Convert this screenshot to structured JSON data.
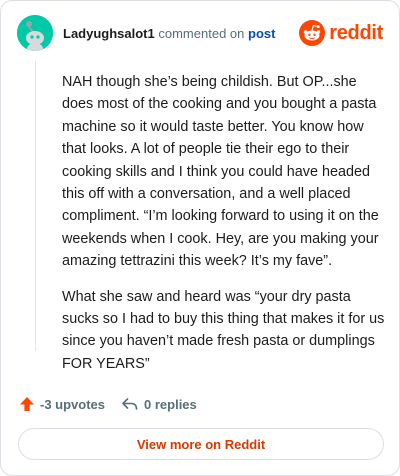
{
  "comment": {
    "author": "Ladyughsalot1",
    "action_text": "commented on",
    "post_link_label": "post"
  },
  "brand": {
    "name": "reddit",
    "icon": "reddit-logo-icon",
    "color": "#ff4500"
  },
  "body": {
    "paragraphs": [
      "NAH though she’s being childish. But OP...she does most of the cooking and you bought a pasta machine so it would taste better. You know how that looks. A lot of people tie their ego to their cooking skills and I think you could have headed this off with a conversation, and a well placed compliment. “I’m looking forward to using it on the weekends when I cook. Hey, are you making your amazing tettrazini this week? It’s my fave”.",
      "What she saw and heard was “your dry pasta sucks so I had to buy this thing that makes it for us since you haven’t made fresh pasta or dumplings FOR YEARS”"
    ]
  },
  "actions": {
    "upvotes_label": "-3 upvotes",
    "upvote_icon": "upvote-arrow-icon",
    "replies_label": "0 replies",
    "reply_icon": "reply-icon"
  },
  "footer": {
    "view_more_label": "View more on Reddit"
  },
  "colors": {
    "accent": "#ff4500",
    "link": "#0a4bb5",
    "muted": "#576f76",
    "avatar_bg": "#00c9a7"
  }
}
